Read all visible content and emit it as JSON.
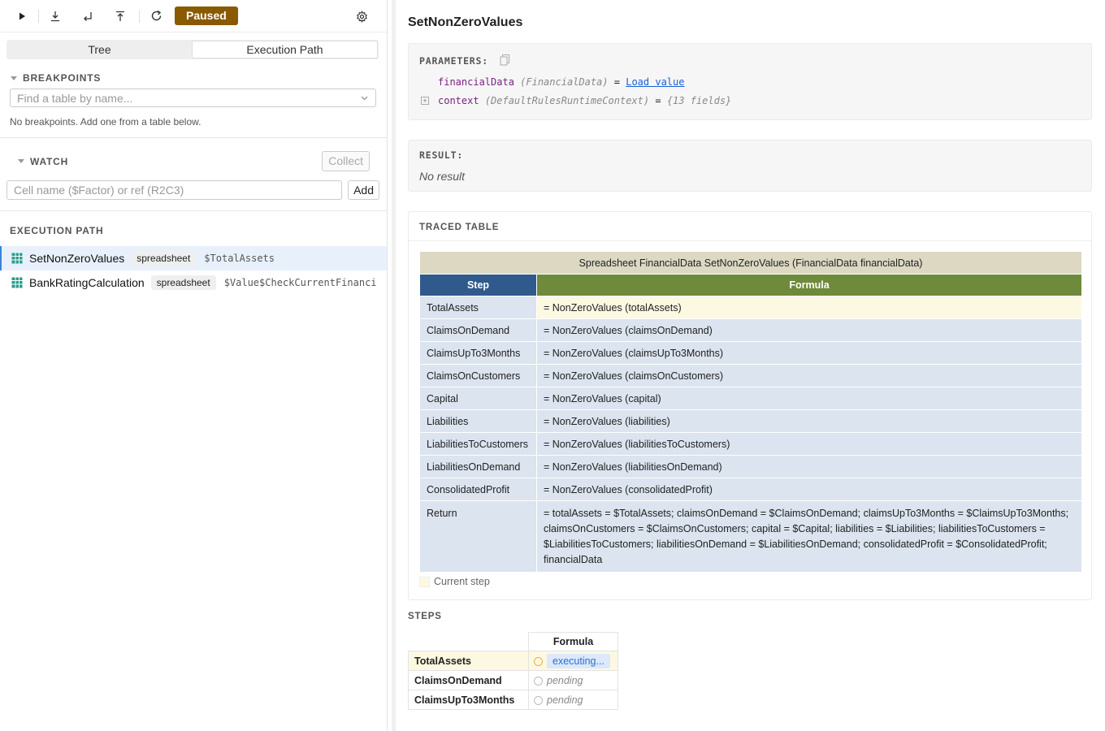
{
  "toolbar": {
    "paused_label": "Paused"
  },
  "tabs": {
    "tree": "Tree",
    "execution_path": "Execution Path",
    "active": "execution_path"
  },
  "breakpoints": {
    "heading": "BREAKPOINTS",
    "placeholder": "Find a table by name...",
    "empty_note": "No breakpoints. Add one from a table below."
  },
  "watch": {
    "heading": "WATCH",
    "collect_label": "Collect",
    "input_placeholder": "Cell name ($Factor) or ref (R2C3)",
    "add_label": "Add"
  },
  "execution_path": {
    "heading": "EXECUTION PATH",
    "items": [
      {
        "name": "SetNonZeroValues",
        "badge": "spreadsheet",
        "ref": "$TotalAssets",
        "selected": true
      },
      {
        "name": "BankRatingCalculation",
        "badge": "spreadsheet",
        "ref": "$Value$CheckCurrentFinanci",
        "selected": false
      }
    ]
  },
  "details": {
    "title": "SetNonZeroValues",
    "parameters_label": "PARAMETERS:",
    "params": [
      {
        "name": "financialData",
        "type": "(FinancialData)",
        "eq": "=",
        "value": "Load value"
      },
      {
        "name": "context",
        "type": "(DefaultRulesRuntimeContext)",
        "eq": "=",
        "value": "{13 fields}"
      }
    ],
    "result_label": "RESULT:",
    "result_value": "No result"
  },
  "traced_table": {
    "heading": "TRACED TABLE",
    "title": "Spreadsheet FinancialData SetNonZeroValues (FinancialData financialData)",
    "header_step": "Step",
    "header_formula": "Formula",
    "rows": [
      {
        "step": "TotalAssets",
        "formula": "= NonZeroValues (totalAssets)"
      },
      {
        "step": "ClaimsOnDemand",
        "formula": "= NonZeroValues (claimsOnDemand)"
      },
      {
        "step": "ClaimsUpTo3Months",
        "formula": "= NonZeroValues (claimsUpTo3Months)"
      },
      {
        "step": "ClaimsOnCustomers",
        "formula": "= NonZeroValues (claimsOnCustomers)"
      },
      {
        "step": "Capital",
        "formula": "= NonZeroValues (capital)"
      },
      {
        "step": "Liabilities",
        "formula": "= NonZeroValues (liabilities)"
      },
      {
        "step": "LiabilitiesToCustomers",
        "formula": "= NonZeroValues (liabilitiesToCustomers)"
      },
      {
        "step": "LiabilitiesOnDemand",
        "formula": "= NonZeroValues (liabilitiesOnDemand)"
      },
      {
        "step": "ConsolidatedProfit",
        "formula": "= NonZeroValues (consolidatedProfit)"
      },
      {
        "step": "Return",
        "formula": "= totalAssets = $TotalAssets; claimsOnDemand = $ClaimsOnDemand; claimsUpTo3Months = $ClaimsUpTo3Months; claimsOnCustomers = $ClaimsOnCustomers; capital = $Capital; liabilities = $Liabilities; liabilitiesToCustomers = $LiabilitiesToCustomers; liabilitiesOnDemand = $LiabilitiesOnDemand; consolidatedProfit = $ConsolidatedProfit; financialData"
      }
    ],
    "legend_label": "Current step"
  },
  "steps": {
    "heading": "STEPS",
    "column": "Formula",
    "rows": [
      {
        "name": "TotalAssets",
        "status": "executing..."
      },
      {
        "name": "ClaimsOnDemand",
        "status": "pending"
      },
      {
        "name": "ClaimsUpTo3Months",
        "status": "pending"
      }
    ]
  },
  "colors": {
    "paused_badge": "#8a5a00",
    "step_header": "#305a8c",
    "formula_header": "#6f8a3a",
    "current_step": "#fdf8e2",
    "link": "#1a5fd6"
  }
}
